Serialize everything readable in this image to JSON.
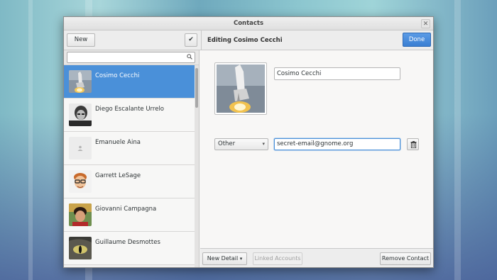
{
  "window": {
    "title": "Contacts"
  },
  "header": {
    "new_label": "New",
    "select_icon": "✔",
    "editing_title": "Editing Cosimo Cecchi",
    "done_label": "Done"
  },
  "sidebar": {
    "search": {
      "placeholder": "",
      "value": ""
    },
    "contacts": [
      {
        "name": "Cosimo Cecchi",
        "avatar": "space-shuttle-photo",
        "selected": true
      },
      {
        "name": "Diego Escalante Urrelo",
        "avatar": "bw-portrait-photo",
        "selected": false
      },
      {
        "name": "Emanuele Aina",
        "avatar": "default-avatar-icon",
        "selected": false
      },
      {
        "name": "Garrett LeSage",
        "avatar": "glasses-portrait-photo",
        "selected": false
      },
      {
        "name": "Giovanni Campagna",
        "avatar": "portrait-photo",
        "selected": false
      },
      {
        "name": "Guillaume Desmottes",
        "avatar": "cat-eye-photo",
        "selected": false
      }
    ]
  },
  "editor": {
    "name_value": "Cosimo Cecchi",
    "detail_type": "Other",
    "email_value": "secret-email@gnome.org"
  },
  "footer": {
    "new_detail_label": "New Detail",
    "linked_accounts_label": "Linked Accounts",
    "remove_contact_label": "Remove Contact"
  },
  "colors": {
    "accent": "#4a90d9",
    "selected_row": "#4a90d9",
    "window_bg": "#f6f5f4"
  }
}
